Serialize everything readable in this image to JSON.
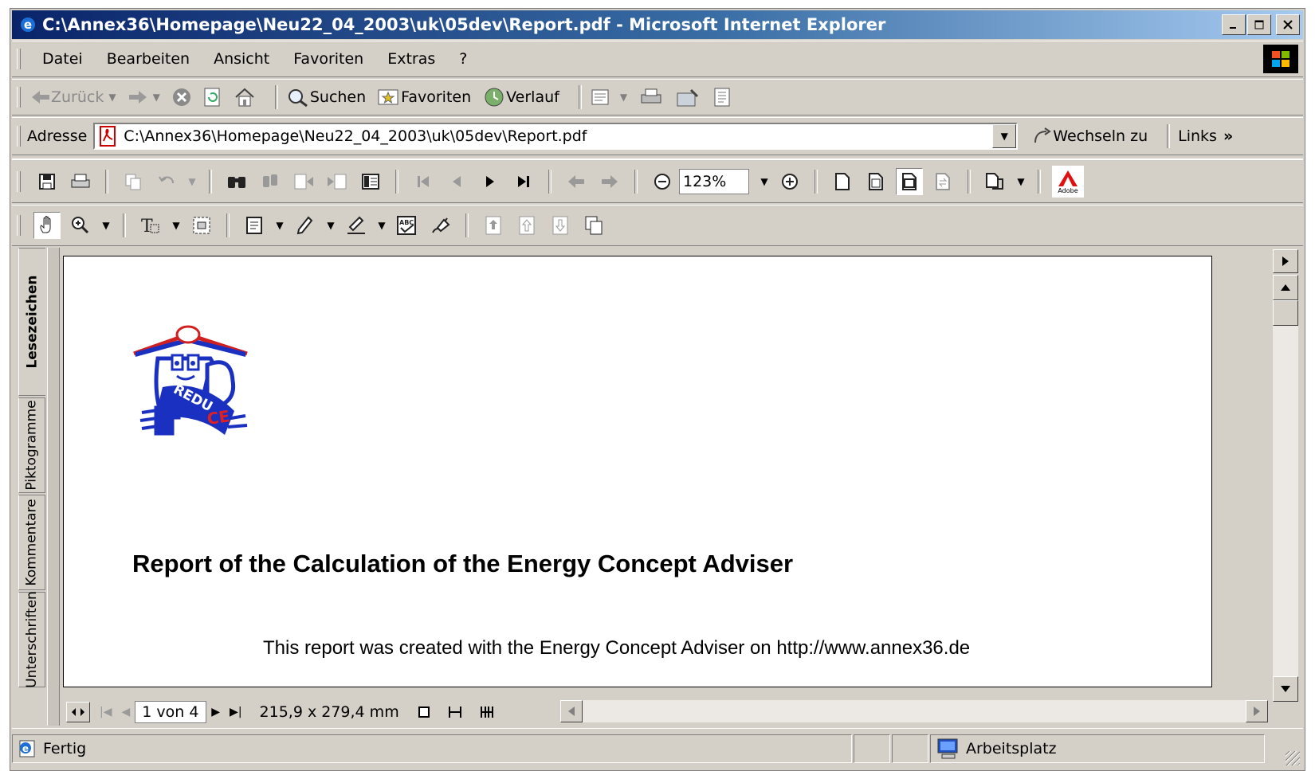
{
  "window": {
    "title": "C:\\Annex36\\Homepage\\Neu22_04_2003\\uk\\05dev\\Report.pdf - Microsoft Internet Explorer"
  },
  "menu": {
    "items": [
      "Datei",
      "Bearbeiten",
      "Ansicht",
      "Favoriten",
      "Extras",
      "?"
    ]
  },
  "nav": {
    "back": "Zurück",
    "search": "Suchen",
    "favorites": "Favoriten",
    "history": "Verlauf"
  },
  "address": {
    "label": "Adresse",
    "value": "C:\\Annex36\\Homepage\\Neu22_04_2003\\uk\\05dev\\Report.pdf",
    "go": "Wechseln zu",
    "links": "Links"
  },
  "acrobat": {
    "zoom": "123%",
    "logo_text": "Adobe"
  },
  "sidetabs": [
    "Lesezeichen",
    "Piktogramme",
    "Kommentare",
    "Unterschriften"
  ],
  "document": {
    "logo_text": "REDUCE",
    "heading": "Report of the Calculation of the Energy Concept Adviser",
    "subtext": "This report was created with the Energy Concept Adviser on http://www.annex36.de"
  },
  "pagebar": {
    "page": "1 von 4",
    "size": "215,9 x 279,4 mm"
  },
  "status": {
    "text": "Fertig",
    "zone": "Arbeitsplatz"
  },
  "colors": {
    "titlebar_start": "#0a246a",
    "titlebar_end": "#a6caf0",
    "chrome": "#d4d0c8"
  }
}
